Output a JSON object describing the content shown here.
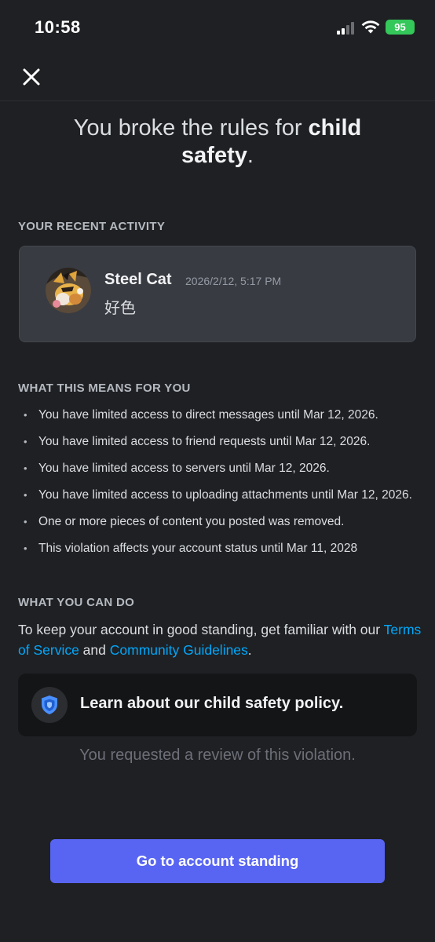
{
  "status_bar": {
    "time": "10:58",
    "battery": "95",
    "icons": [
      "cellular-signal-icon",
      "wifi-icon",
      "battery-icon"
    ],
    "battery_color": "#34c759"
  },
  "header": {
    "close_icon": "close-icon",
    "title_prefix": "You broke the rules for ",
    "title_bold": "child safety",
    "title_suffix": "."
  },
  "recent_activity": {
    "label": "YOUR RECENT ACTIVITY",
    "author": "Steel Cat",
    "timestamp": "2026/2/12, 5:17 PM",
    "content": "好色"
  },
  "meaning": {
    "label": "WHAT THIS MEANS FOR YOU",
    "items": [
      "You have limited access to direct messages until Mar 12, 2026.",
      "You have limited access to friend requests until Mar 12, 2026.",
      "You have limited access to servers until Mar 12, 2026.",
      "You have limited access to uploading attachments until Mar 12, 2026.",
      "One or more pieces of content you posted was removed.",
      "This violation affects your account status until Mar 11, 2028"
    ]
  },
  "can_do": {
    "label": "WHAT YOU CAN DO",
    "text_prefix": "To keep your account in good standing, get familiar with our ",
    "tos_link": "Terms of Service",
    "text_mid": " and ",
    "guidelines_link": "Community Guidelines",
    "text_suffix": "."
  },
  "policy_card": {
    "icon": "shield-icon",
    "label": "Learn about our child safety policy."
  },
  "review_note": "You requested a review of this violation.",
  "cta": {
    "label": "Go to account standing",
    "color": "#5865f2"
  },
  "colors": {
    "background": "#1f2023",
    "link": "#00a8fc",
    "card": "#393b42"
  }
}
